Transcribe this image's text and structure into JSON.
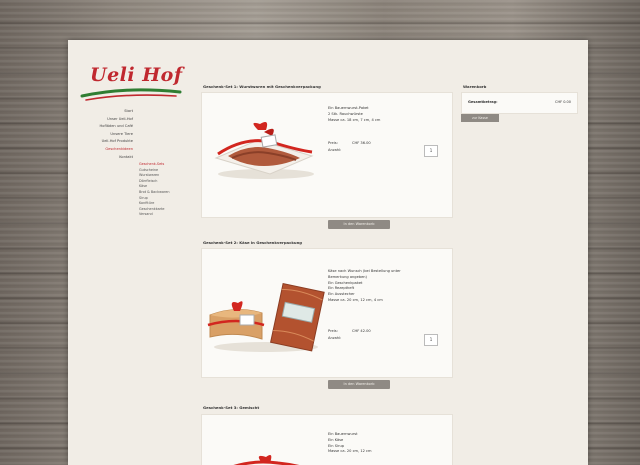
{
  "logo": {
    "text": "Ueli Hof"
  },
  "nav": {
    "items": [
      "Start",
      "Unser Ueli-Hof",
      "Hofläden und Café",
      "Unsere Tiere",
      "Ueli-Hof Produkte",
      "Geschenkideen",
      "Kontakt"
    ],
    "active_index": 5
  },
  "subnav": {
    "items": [
      "Geschenk-Sets",
      "Gutscheine",
      "Wurstwaren",
      "Dörrfleisch",
      "Käse",
      "Brot & Backwaren",
      "Sirup",
      "Konfitüre",
      "Geschenkkarte",
      "Versand"
    ],
    "active_index": 0
  },
  "products": [
    {
      "title": "Geschenk-Set 1: Wurstwaren mit Geschenkverpackung",
      "desc": [
        "Ein Bauernwurst-Paket",
        "2 Stk. Rauchwürste",
        "Masse ca. 18 cm, 7 cm, 4 cm"
      ],
      "price_label": "Preis:",
      "qty_label": "Anzahl:",
      "price": "CHF 36.00",
      "qty": "1",
      "button": "In den Warenkorb"
    },
    {
      "title": "Geschenk-Set 2: Käse in Geschenkverpackung",
      "desc": [
        "Käse nach Wunsch (bei Bestellung unter",
        "Bemerkung angeben)",
        "Ein Geschenkpaket",
        "Ein Rezeptheft",
        "Ein Ausstecher",
        "Masse ca. 20 cm, 12 cm, 4 cm"
      ],
      "price_label": "Preis:",
      "qty_label": "Anzahl:",
      "price": "CHF 42.00",
      "qty": "1",
      "button": "In den Warenkorb"
    },
    {
      "title": "Geschenk-Set 3: Gemischt",
      "desc": [
        "Ein Bauernwurst",
        "Ein Käse",
        "Ein Sirup",
        "Masse ca. 20 cm, 12 cm"
      ],
      "price_label": "",
      "qty_label": "",
      "price": "",
      "qty": "",
      "button": ""
    }
  ],
  "cart": {
    "title": "Warenkorb",
    "total_label": "Gesamtbetrag:",
    "total_value": "CHF 0.00",
    "button": "zur Kasse"
  },
  "colors": {
    "accent": "#c0282f",
    "green": "#2f7d32",
    "button": "#8f8a84",
    "page": "#f1ede6"
  }
}
